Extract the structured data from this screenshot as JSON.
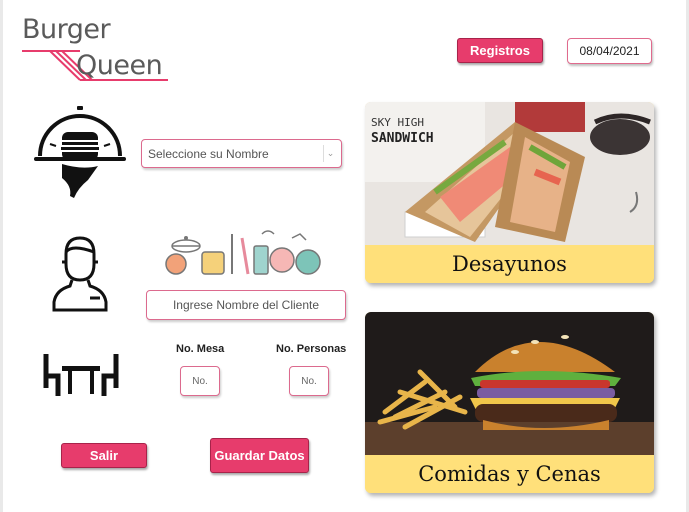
{
  "app": {
    "logo_line1": "Burger",
    "logo_line2": "Queen"
  },
  "header": {
    "registros_label": "Registros",
    "date": "08/04/2021"
  },
  "form": {
    "select_placeholder": "Seleccione su Nombre",
    "client_placeholder": "Ingrese Nombre del Cliente",
    "mesa_label": "No. Mesa",
    "mesa_placeholder": "No.",
    "personas_label": "No. Personas",
    "personas_placeholder": "No."
  },
  "actions": {
    "salir_label": "Salir",
    "guardar_label": "Guardar Datos"
  },
  "menu": {
    "breakfast_label": "Desayunos",
    "breakfast_photo_text_1": "SKY HIGH",
    "breakfast_photo_text_2": "SANDWICH",
    "meals_label": "Comidas y Cenas"
  },
  "icons": {
    "waiter": "waiter-cloche-icon",
    "person": "person-icon",
    "table": "table-chairs-icon",
    "kitchen": "kitchen-utensils-icon"
  },
  "colors": {
    "accent": "#e73c6c",
    "card_label_bg": "#ffe07a",
    "border_pink": "#dc6a8e"
  }
}
